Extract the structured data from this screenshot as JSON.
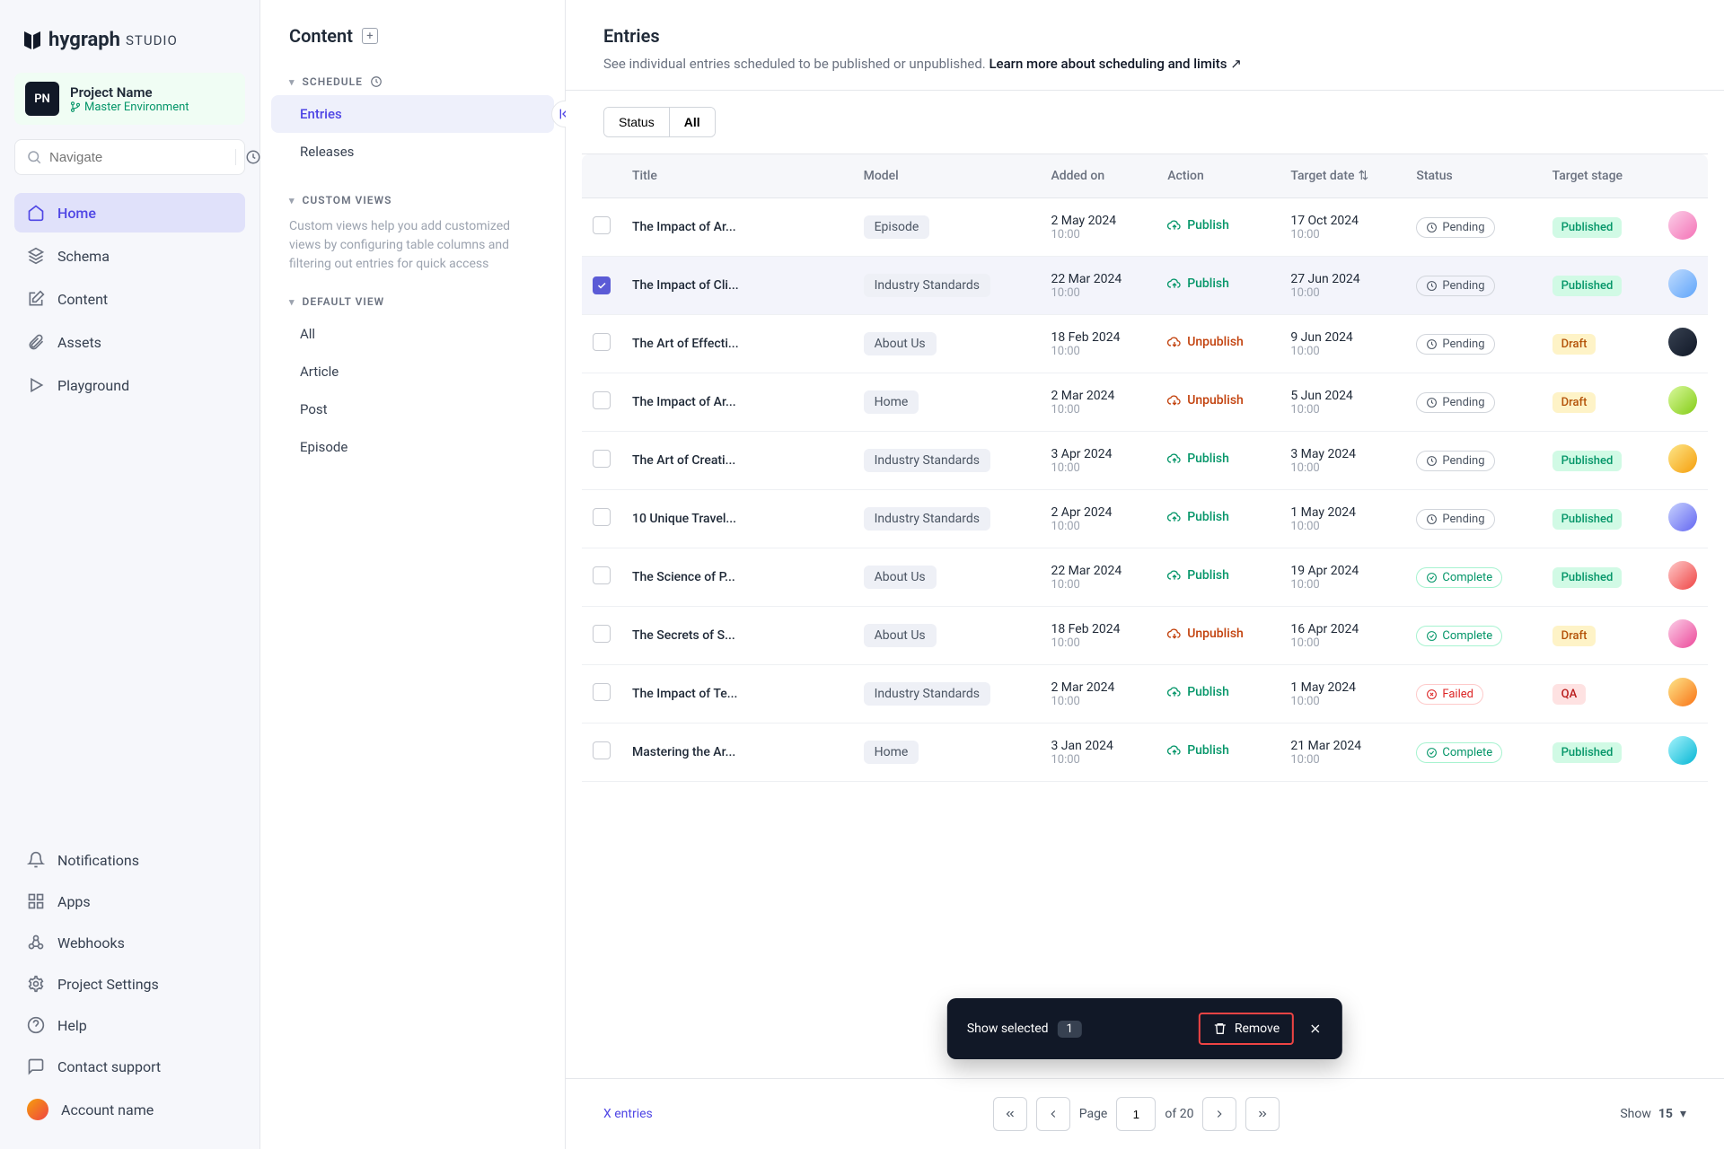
{
  "logo": {
    "brand": "hygraph",
    "suffix": "STUDIO"
  },
  "project": {
    "initials": "PN",
    "name": "Project Name",
    "env": "Master Environment"
  },
  "search": {
    "placeholder": "Navigate"
  },
  "nav": {
    "home": "Home",
    "schema": "Schema",
    "content": "Content",
    "assets": "Assets",
    "playground": "Playground",
    "notifications": "Notifications",
    "apps": "Apps",
    "webhooks": "Webhooks",
    "settings": "Project Settings",
    "help": "Help",
    "support": "Contact support",
    "account": "Account name"
  },
  "panel2": {
    "title": "Content",
    "schedule_label": "SCHEDULE",
    "entries": "Entries",
    "releases": "Releases",
    "custom_label": "CUSTOM VIEWS",
    "custom_desc": "Custom views help you add customized views by configuring table columns and filtering out entries for quick access",
    "default_label": "DEFAULT VIEW",
    "default_items": [
      "All",
      "Article",
      "Post",
      "Episode"
    ]
  },
  "main": {
    "title": "Entries",
    "subtitle_prefix": "See individual entries scheduled to be published or unpublished. ",
    "subtitle_link": "Learn more about scheduling and limits",
    "filter_status": "Status",
    "filter_all": "All",
    "columns": {
      "title": "Title",
      "model": "Model",
      "added": "Added on",
      "action": "Action",
      "target": "Target date",
      "status": "Status",
      "stage": "Target stage"
    },
    "rows": [
      {
        "checked": false,
        "title": "The Impact of Ar...",
        "model": "Episode",
        "date": "2 May 2024",
        "time": "10:00",
        "action": "Publish",
        "action_type": "publish",
        "target_date": "17 Oct 2024",
        "target_time": "10:00",
        "status": "Pending",
        "status_type": "pending",
        "stage": "Published",
        "stage_type": "published"
      },
      {
        "checked": true,
        "title": "The Impact of Cli...",
        "model": "Industry Standards",
        "date": "22 Mar 2024",
        "time": "10:00",
        "action": "Publish",
        "action_type": "publish",
        "target_date": "27 Jun 2024",
        "target_time": "10:00",
        "status": "Pending",
        "status_type": "pending",
        "stage": "Published",
        "stage_type": "published"
      },
      {
        "checked": false,
        "title": "The Art of Effecti...",
        "model": "About Us",
        "date": "18 Feb 2024",
        "time": "10:00",
        "action": "Unpublish",
        "action_type": "unpublish",
        "target_date": "9 Jun 2024",
        "target_time": "10:00",
        "status": "Pending",
        "status_type": "pending",
        "stage": "Draft",
        "stage_type": "draft"
      },
      {
        "checked": false,
        "title": "The Impact of Ar...",
        "model": "Home",
        "date": "2 Mar 2024",
        "time": "10:00",
        "action": "Unpublish",
        "action_type": "unpublish",
        "target_date": "5 Jun 2024",
        "target_time": "10:00",
        "status": "Pending",
        "status_type": "pending",
        "stage": "Draft",
        "stage_type": "draft"
      },
      {
        "checked": false,
        "title": "The Art of Creati...",
        "model": "Industry Standards",
        "date": "3 Apr 2024",
        "time": "10:00",
        "action": "Publish",
        "action_type": "publish",
        "target_date": "3 May 2024",
        "target_time": "10:00",
        "status": "Pending",
        "status_type": "pending",
        "stage": "Published",
        "stage_type": "published"
      },
      {
        "checked": false,
        "title": "10 Unique Travel...",
        "model": "Industry Standards",
        "date": "2 Apr 2024",
        "time": "10:00",
        "action": "Publish",
        "action_type": "publish",
        "target_date": "1 May 2024",
        "target_time": "10:00",
        "status": "Pending",
        "status_type": "pending",
        "stage": "Published",
        "stage_type": "published"
      },
      {
        "checked": false,
        "title": "The Science of P...",
        "model": "About Us",
        "date": "22 Mar 2024",
        "time": "10:00",
        "action": "Publish",
        "action_type": "publish",
        "target_date": "19 Apr 2024",
        "target_time": "10:00",
        "status": "Complete",
        "status_type": "complete",
        "stage": "Published",
        "stage_type": "published"
      },
      {
        "checked": false,
        "title": "The Secrets of S...",
        "model": "About Us",
        "date": "18 Feb 2024",
        "time": "10:00",
        "action": "Unpublish",
        "action_type": "unpublish",
        "target_date": "16 Apr 2024",
        "target_time": "10:00",
        "status": "Complete",
        "status_type": "complete",
        "stage": "Draft",
        "stage_type": "draft"
      },
      {
        "checked": false,
        "title": "The Impact of Te...",
        "model": "Industry Standards",
        "date": "2 Mar 2024",
        "time": "10:00",
        "action": "Publish",
        "action_type": "publish",
        "target_date": "1 May 2024",
        "target_time": "10:00",
        "status": "Failed",
        "status_type": "failed",
        "stage": "QA",
        "stage_type": "qa"
      },
      {
        "checked": false,
        "title": "Mastering the Ar...",
        "model": "Home",
        "date": "3 Jan 2024",
        "time": "10:00",
        "action": "Publish",
        "action_type": "publish",
        "target_date": "21 Mar 2024",
        "target_time": "10:00",
        "status": "Complete",
        "status_type": "complete",
        "stage": "Published",
        "stage_type": "published"
      }
    ]
  },
  "selection_bar": {
    "show": "Show selected",
    "count": "1",
    "remove": "Remove"
  },
  "footer": {
    "entries": "X entries",
    "page_label": "Page",
    "page_value": "1",
    "of": "of 20",
    "show_label": "Show",
    "show_value": "15"
  }
}
